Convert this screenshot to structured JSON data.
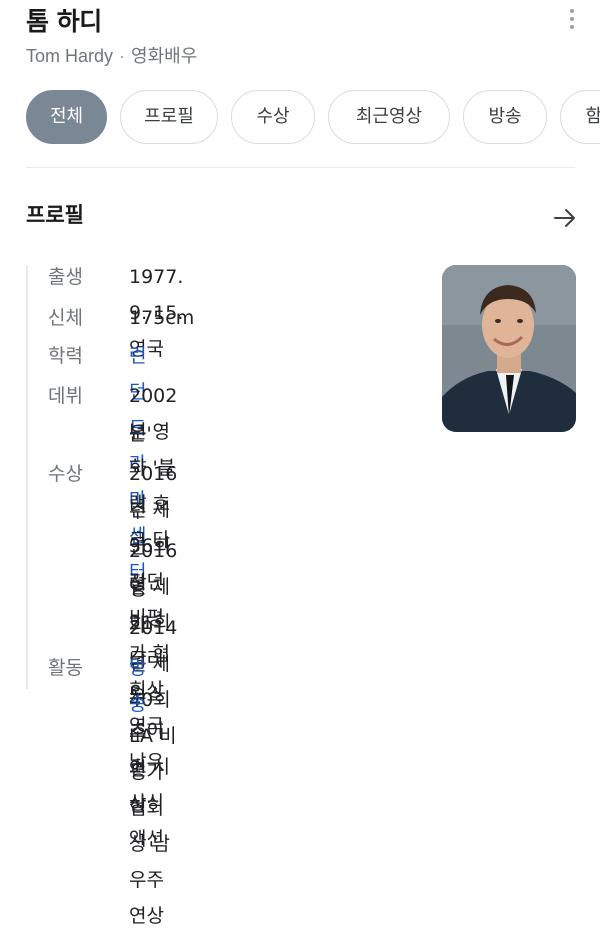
{
  "header": {
    "title": "톰 하디",
    "name_en": "Tom Hardy",
    "separator": "·",
    "occupation": "영화배우"
  },
  "tabs": [
    {
      "label": "전체",
      "active": true
    },
    {
      "label": "프로필",
      "active": false
    },
    {
      "label": "수상",
      "active": false
    },
    {
      "label": "최근영상",
      "active": false
    },
    {
      "label": "방송",
      "active": false
    },
    {
      "label": "함께",
      "active": false
    }
  ],
  "profile": {
    "section_title": "프로필",
    "birth": {
      "label": "출생",
      "value": "1977. 9. 15. 영국"
    },
    "body": {
      "label": "신체",
      "value": "175cm"
    },
    "education": {
      "label": "학력",
      "value": "런던드라마센터"
    },
    "debut": {
      "label": "데뷔",
      "line1": "2002년 영화 '블랙 호크 다",
      "line2": "운'"
    },
    "awards": {
      "label": "수상",
      "items": [
        {
          "line1": "2016년 제36회 런던 비평가 협회상 영국남우",
          "line2": "주연상"
        },
        {
          "line1": "2016년 제21회 크리틱스 초이스 시상식 액션",
          "line2": "영화 남우주연상"
        },
        {
          "line1": "2014년 제40회 LA 비평가 협회상 남우주연상"
        }
      ]
    },
    "activity": {
      "label": "활동",
      "value": "방송"
    }
  },
  "colors": {
    "active_tab_bg": "#7a8795",
    "link": "#1a56c9",
    "label": "#70757a"
  }
}
